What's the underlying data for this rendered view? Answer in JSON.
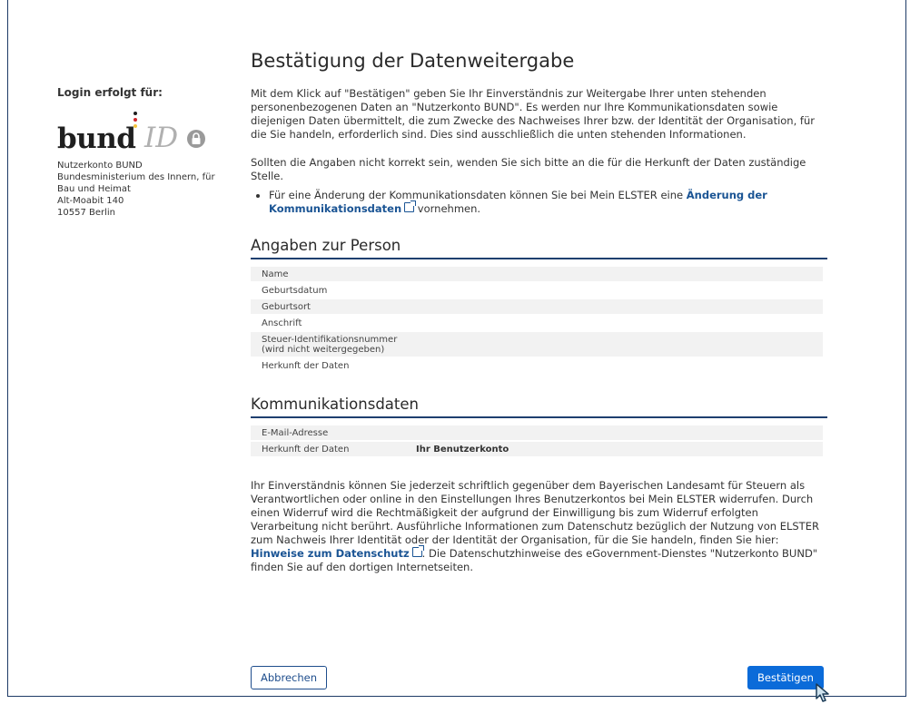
{
  "sidebar": {
    "login_label": "Login erfolgt für:",
    "logo": {
      "word": "bund",
      "id": "ID",
      "dot_colors": [
        "#1f1f1f",
        "#d1252b",
        "#f6c43d"
      ]
    },
    "address_lines": [
      "Nutzerkonto BUND",
      "Bundesministerium des Innern, für",
      "Bau und Heimat",
      "Alt-Moabit 140",
      "10557 Berlin"
    ]
  },
  "main": {
    "title": "Bestätigung der Datenweitergabe",
    "intro": "Mit dem Klick auf \"Bestätigen\" geben Sie Ihr Einverständnis zur Weitergabe Ihrer unten stehenden personenbezogenen Daten an \"Nutzerkonto BUND\". Es werden nur Ihre Kommunikationsdaten sowie diejenigen Daten übermittelt, die zum Zwecke des Nachweises Ihrer bzw. der Identität der Organisation, für die Sie handeln, erforderlich sind. Dies sind ausschließlich die unten stehenden Informationen.",
    "contact_text": "Sollten die Angaben nicht korrekt sein, wenden Sie sich bitte an die für die Herkunft der Daten zuständige Stelle.",
    "bullet_prefix": "Für eine Änderung der Kommunikationsdaten können Sie bei Mein ELSTER eine ",
    "bullet_link": "Änderung der Kommunikationsdaten",
    "bullet_suffix": " vornehmen."
  },
  "person": {
    "heading": "Angaben zur Person",
    "rows": [
      {
        "label": "Name",
        "value": ""
      },
      {
        "label": "Geburtsdatum",
        "value": ""
      },
      {
        "label": "Geburtsort",
        "value": ""
      },
      {
        "label": "Anschrift",
        "value": ""
      },
      {
        "label": "Steuer-Identifikationsnummer",
        "sublabel": "(wird nicht weitergegeben)",
        "value": ""
      },
      {
        "label": "Herkunft der Daten",
        "value": ""
      }
    ]
  },
  "communication": {
    "heading": "Kommunikationsdaten",
    "rows": [
      {
        "label": "E-Mail-Adresse",
        "value": ""
      },
      {
        "label": "Herkunft der Daten",
        "value": "Ihr Benutzerkonto"
      }
    ]
  },
  "consent": {
    "text": "Ihr Einverständnis können Sie jederzeit schriftlich gegenüber dem Bayerischen Landesamt für Steuern als Verantwortlichen oder online in den Einstellungen Ihres Benutzerkontos bei Mein ELSTER widerrufen. Durch einen Widerruf wird die Rechtmäßigkeit der aufgrund der Einwilligung bis zum Widerruf erfolgten Verarbeitung nicht berührt. Ausführliche Informationen zum Datenschutz bezüglich der Nutzung von ELSTER zum Nachweis Ihrer Identität oder der Identität der Organisation, für die Sie handeln, finden Sie hier: ",
    "link": "Hinweise zum Datenschutz",
    "suffix": ". Die Datenschutzhinweise des eGovernment-Dienstes \"Nutzerkonto BUND\" finden Sie auf den dortigen Internetseiten."
  },
  "buttons": {
    "cancel": "Abbrechen",
    "confirm": "Bestätigen"
  },
  "colors": {
    "accent": "#0b6bd9",
    "heading_rule": "#1e3f6f",
    "link": "#1a5494"
  }
}
